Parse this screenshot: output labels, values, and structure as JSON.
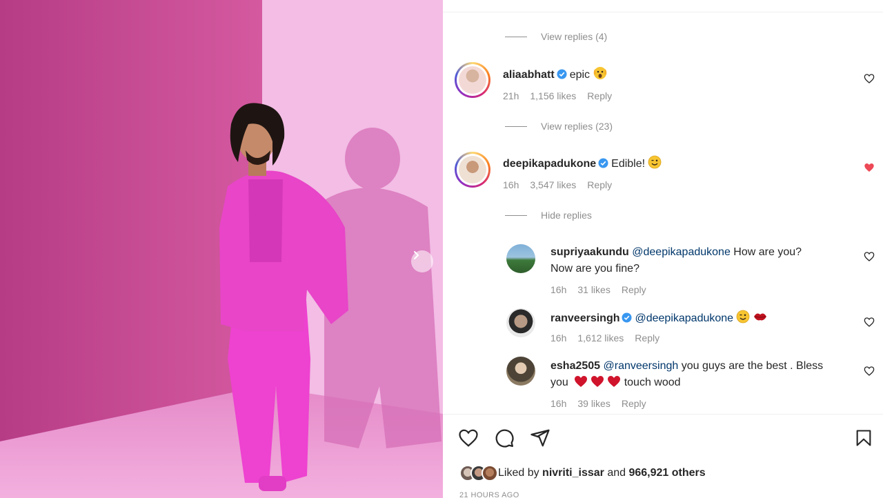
{
  "post": {
    "next_icon": "chevron-right-icon"
  },
  "comments": [
    {
      "view_replies_above": "View replies (4)",
      "username": "aliaabhatt",
      "verified": true,
      "text": "epic",
      "emoji": "scream-emoji",
      "time": "21h",
      "likes": "1,156 likes",
      "reply": "Reply",
      "liked": false
    },
    {
      "view_replies_above": "View replies (23)",
      "username": "deepikapadukone",
      "verified": true,
      "text": "Edible!",
      "emoji": "wink-emoji",
      "time": "16h",
      "likes": "3,547 likes",
      "reply": "Reply",
      "liked": true,
      "hide_replies": "Hide replies"
    }
  ],
  "replies": [
    {
      "username": "supriyaakundu",
      "mention": "@deepikapadukone",
      "text_line1": "How are you?",
      "text_line2": "Now are you fine?",
      "time": "16h",
      "likes": "31 likes",
      "reply": "Reply"
    },
    {
      "username": "ranveersingh",
      "verified": true,
      "mention": "@deepikapadukone",
      "emojis": [
        "wink-emoji",
        "kiss-lips-emoji"
      ],
      "time": "16h",
      "likes": "1,612 likes",
      "reply": "Reply"
    },
    {
      "username": "esha2505",
      "mention": "@ranveersingh",
      "text_line1": "you guys are the best . Bless",
      "text_line2_a": "you",
      "text_line2_b": "touch wood",
      "time": "16h",
      "likes": "39 likes",
      "reply": "Reply"
    }
  ],
  "actions": {
    "like_icon": "heart-icon",
    "comment_icon": "comment-icon",
    "share_icon": "send-icon",
    "save_icon": "bookmark-icon"
  },
  "liked_by": {
    "prefix": "Liked by",
    "user": "nivriti_issar",
    "middle": "and",
    "others": "966,921 others"
  },
  "timestamp": "21 HOURS AGO",
  "colors": {
    "liked_heart": "#ed4956",
    "mention": "#00376b",
    "verified": "#3897f0",
    "muted": "#8e8e8e"
  }
}
